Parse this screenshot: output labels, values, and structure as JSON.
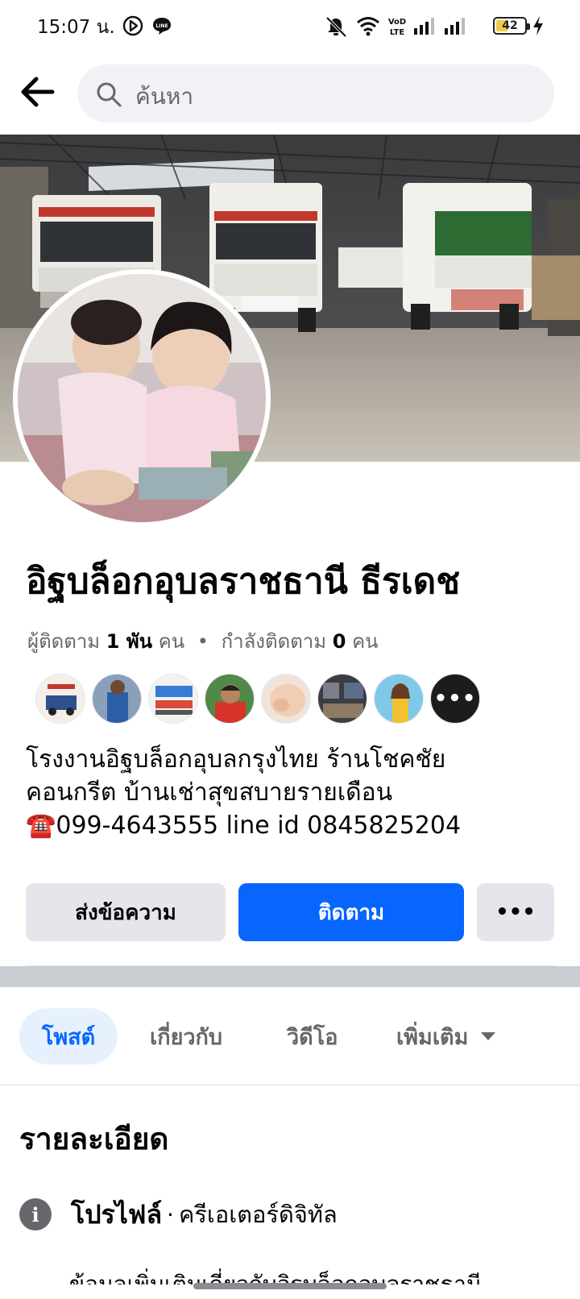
{
  "status_bar": {
    "time": "15:07 น.",
    "battery": "42",
    "battery_level_percent": 42,
    "icons": [
      "navigation-icon",
      "line-app-icon",
      "mute-icon",
      "wifi-icon",
      "volte-icon",
      "signal-icon",
      "signal-icon",
      "battery-icon",
      "charging-icon"
    ]
  },
  "topbar": {
    "back_icon": "back-arrow-icon",
    "search_placeholder": "ค้นหา"
  },
  "profile": {
    "name": "อิฐบล็อกอุบลราชธานี ธีรเดช",
    "followers_label": "ผู้ติดตาม",
    "followers_count": "1 พัน",
    "followers_unit": "คน",
    "separator": "•",
    "following_label": "กำลังติดตาม",
    "following_count": "0",
    "following_unit": "คน",
    "bio_lines": [
      "โรงงานอิฐบล็อกอุบลกรุงไทย ร้านโชคชัย",
      "คอนกรีต บ้านเช่าสุขสบายรายเดือน",
      "☎️099-4643555 line id 0845825204"
    ],
    "follower_avatars_more": "•••"
  },
  "actions": {
    "message": "ส่งข้อความ",
    "follow": "ติดตาม",
    "more": "•••"
  },
  "tabs": [
    {
      "label": "โพสต์",
      "active": true
    },
    {
      "label": "เกี่ยวกับ",
      "active": false
    },
    {
      "label": "วิดีโอ",
      "active": false
    },
    {
      "label": "เพิ่มเติม",
      "active": false
    }
  ],
  "details": {
    "title": "รายละเอียด",
    "info_icon_glyph": "i",
    "profile_label": "โปรไฟล์",
    "profile_sep": "·",
    "profile_value": "ครีเอเตอร์ดิจิทัล",
    "next_row_partial": "ข้อมูลเพิ่มเติมเกี่ยวกับอิฐบล็อกอุบลราชธานี"
  },
  "colors": {
    "primary_blue": "#0866ff",
    "button_gray": "#e4e6eb",
    "secondary_text": "#65676b"
  }
}
